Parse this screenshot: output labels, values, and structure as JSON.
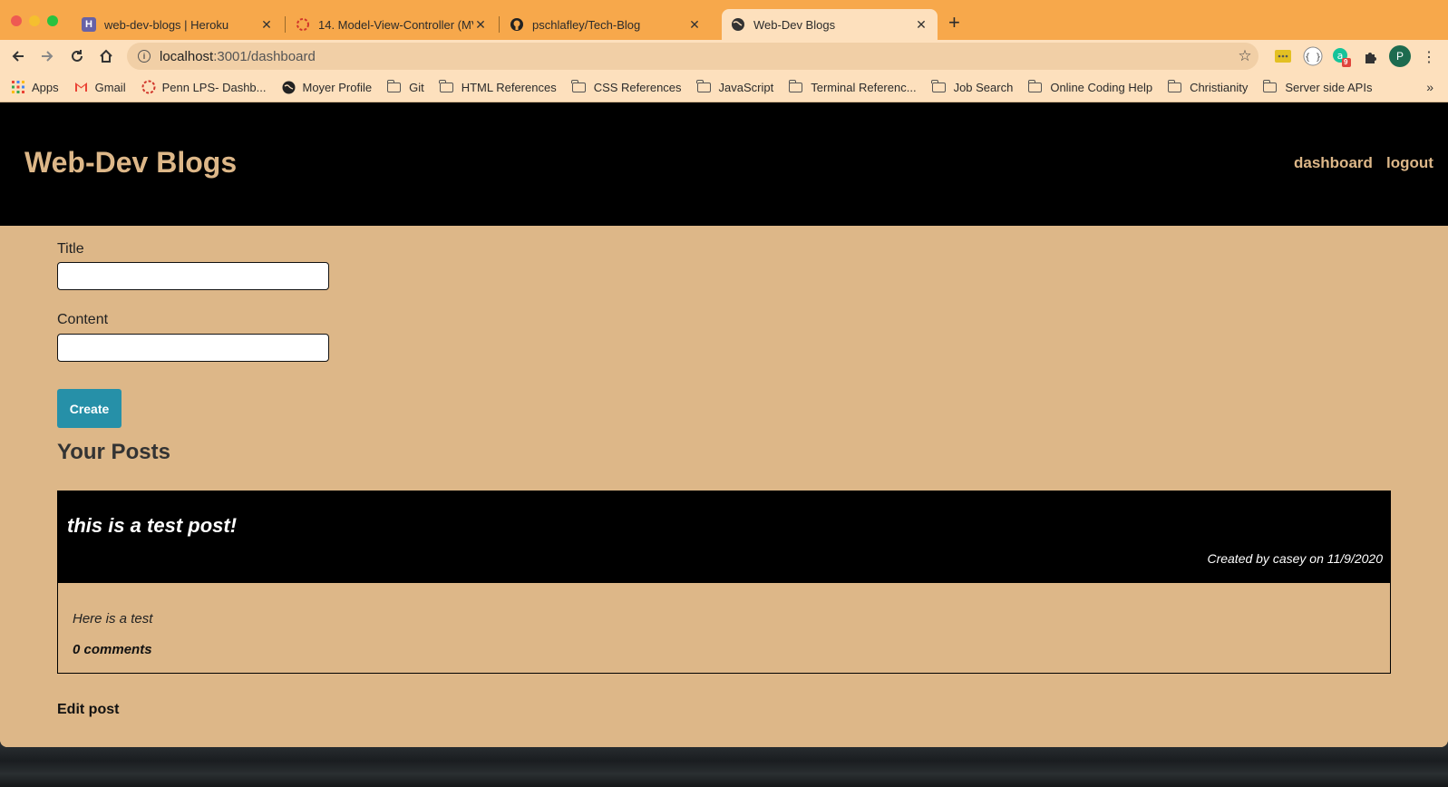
{
  "browser": {
    "tabs": [
      {
        "title": "web-dev-blogs | Heroku",
        "favicon": "heroku-icon",
        "active": false
      },
      {
        "title": "14. Model-View-Controller (MV",
        "favicon": "loading-ring-icon",
        "active": false
      },
      {
        "title": "pschlafley/Tech-Blog",
        "favicon": "github-icon",
        "active": false
      },
      {
        "title": "Web-Dev Blogs",
        "favicon": "globe-icon",
        "active": true
      }
    ],
    "url_host": "localhost",
    "url_path": ":3001/dashboard",
    "profile_initial": "P",
    "extension_badge": "9",
    "bookmarks": [
      {
        "label": "Apps",
        "icon": "apps-grid-icon"
      },
      {
        "label": "Gmail",
        "icon": "gmail-icon"
      },
      {
        "label": "Penn LPS- Dashb...",
        "icon": "penn-icon"
      },
      {
        "label": "Moyer Profile",
        "icon": "moyer-icon"
      },
      {
        "label": "Git",
        "icon": "folder-icon"
      },
      {
        "label": "HTML References",
        "icon": "folder-icon"
      },
      {
        "label": "CSS References",
        "icon": "folder-icon"
      },
      {
        "label": "JavaScript",
        "icon": "folder-icon"
      },
      {
        "label": "Terminal Referenc...",
        "icon": "folder-icon"
      },
      {
        "label": "Job Search",
        "icon": "folder-icon"
      },
      {
        "label": "Online Coding Help",
        "icon": "folder-icon"
      },
      {
        "label": "Christianity",
        "icon": "folder-icon"
      },
      {
        "label": "Server side APIs",
        "icon": "folder-icon"
      }
    ]
  },
  "site": {
    "brand": "Web-Dev Blogs",
    "nav": {
      "dashboard": "dashboard",
      "logout": "logout"
    }
  },
  "form": {
    "title_label": "Title",
    "title_value": "",
    "content_label": "Content",
    "content_value": "",
    "create_label": "Create"
  },
  "posts_section": {
    "heading": "Your Posts",
    "posts": [
      {
        "title": "this is a test post!",
        "meta": "Created by casey on 11/9/2020",
        "content": "Here is a test",
        "comments": "0 comments"
      }
    ],
    "edit_label": "Edit post"
  },
  "colors": {
    "tab_strip": "#f7a84b",
    "toolbar": "#fde0bd",
    "page_bg": "#ddb788",
    "header_bg": "#000000",
    "button": "#2690a8"
  }
}
